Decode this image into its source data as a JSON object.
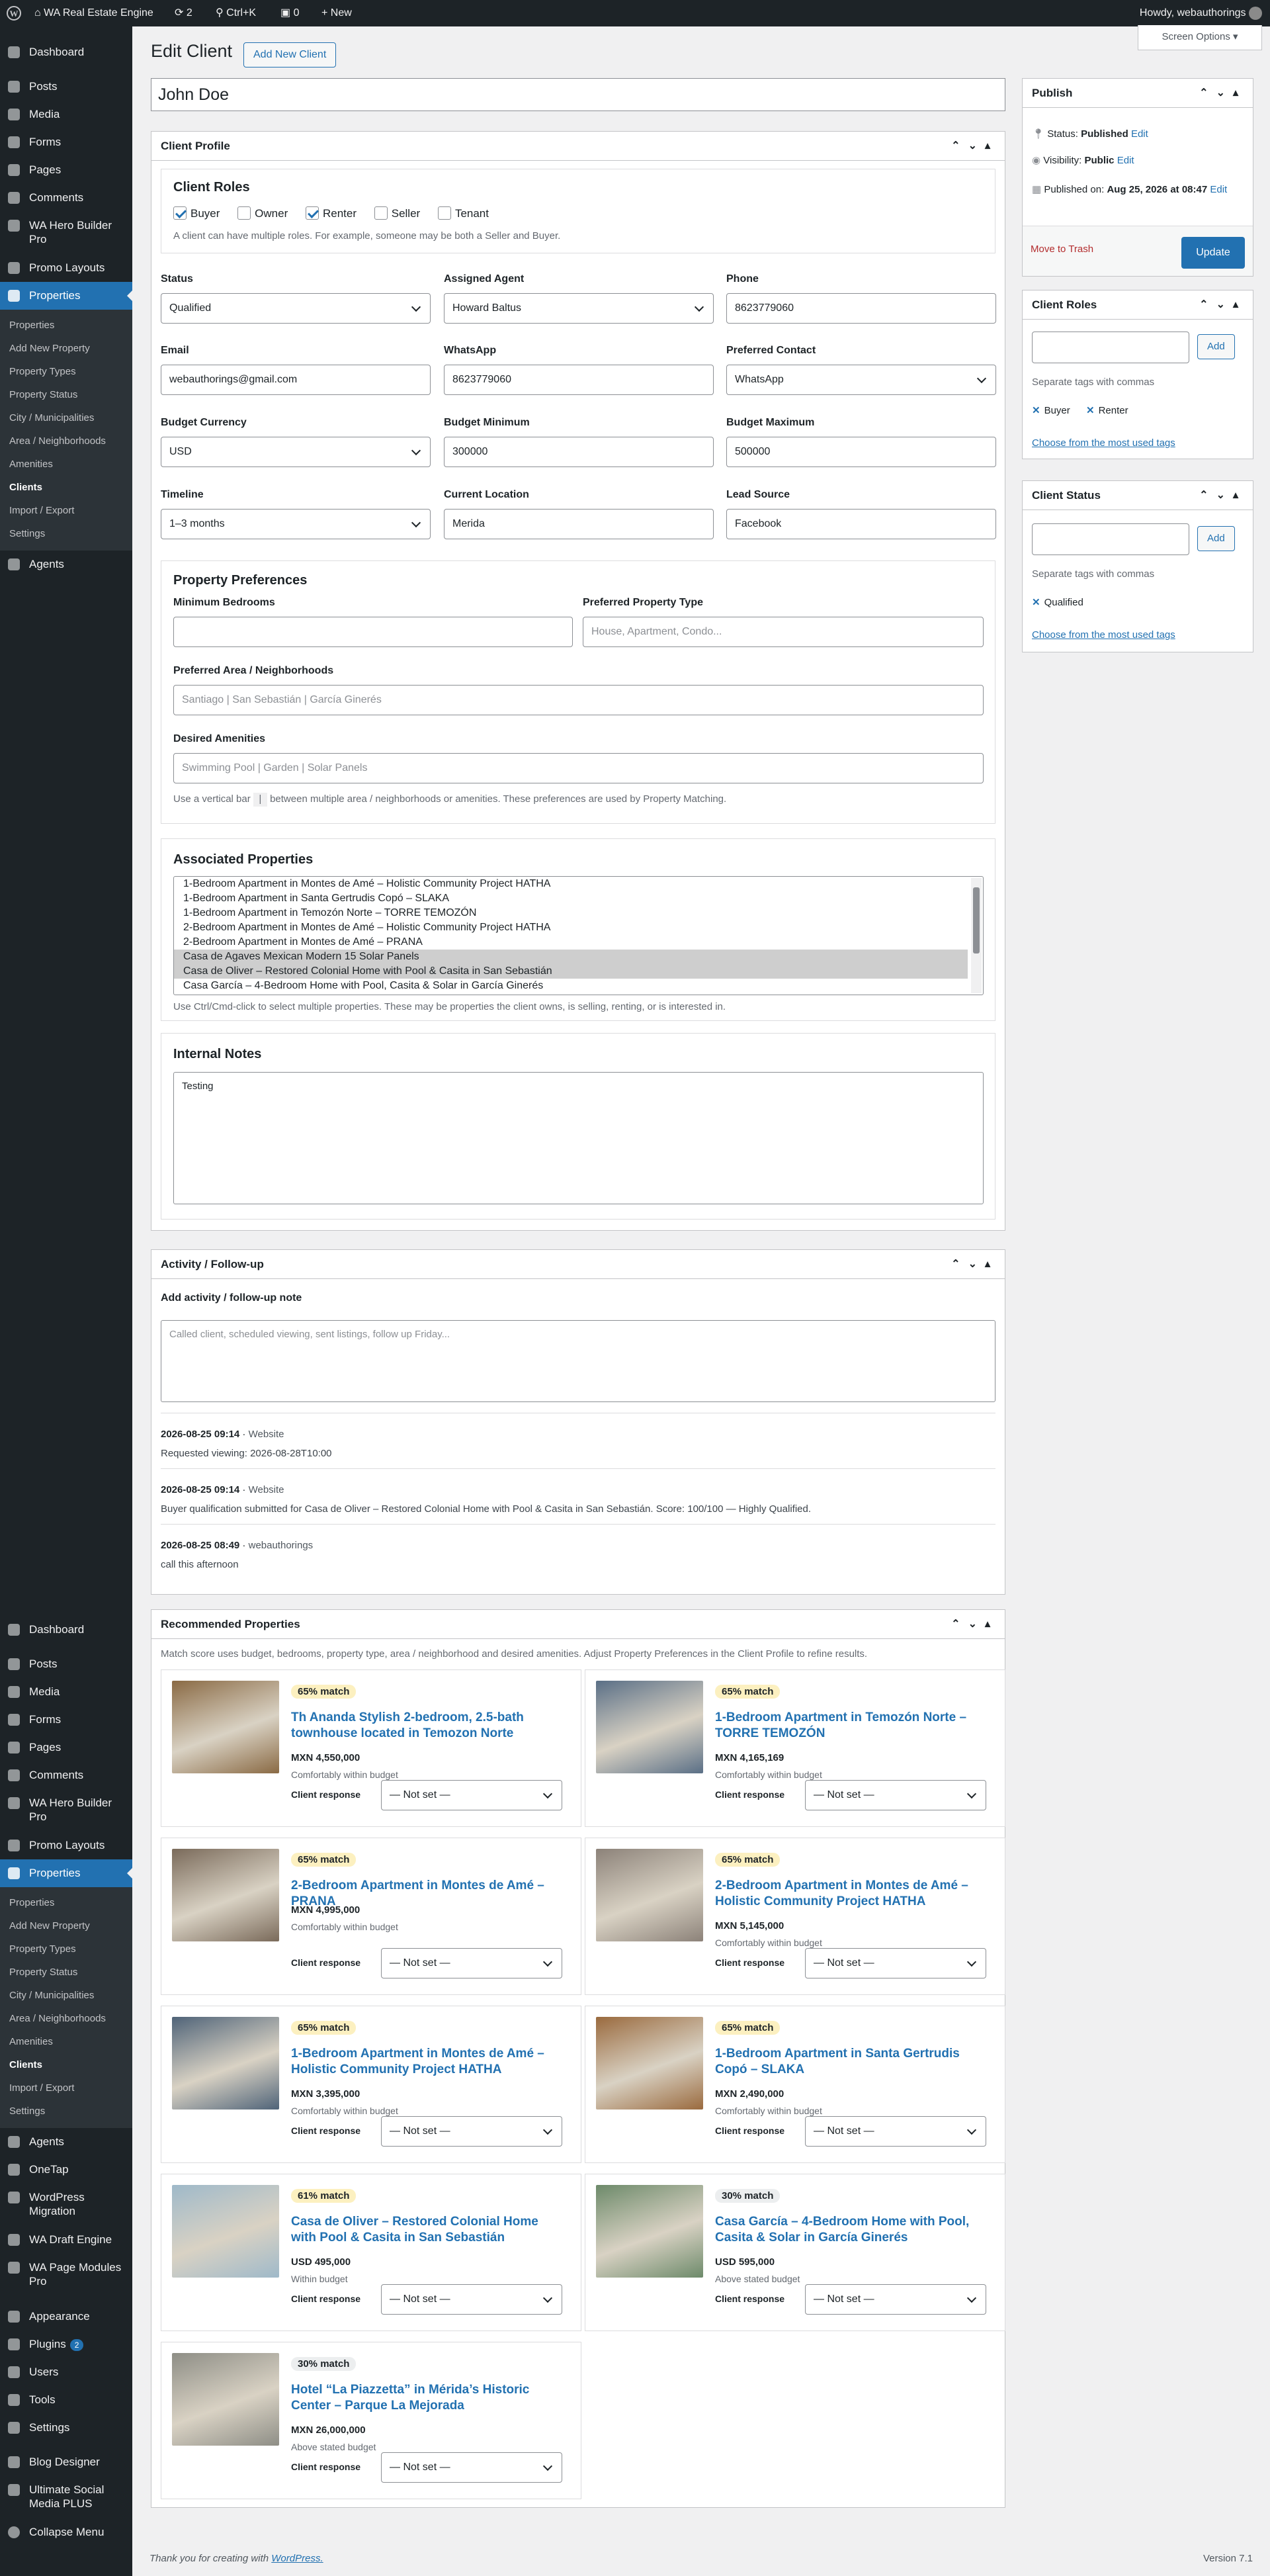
{
  "adminbar": {
    "site": "WA Real Estate Engine",
    "updates": "2",
    "search": "Ctrl+K",
    "comments": "0",
    "new": "New",
    "howdy": "Howdy, webauthorings"
  },
  "menu": {
    "top": [
      {
        "label": "Dashboard",
        "icon": "dashboard-icon"
      },
      {
        "label": "Posts",
        "icon": "pin-icon"
      },
      {
        "label": "Media",
        "icon": "media-icon"
      },
      {
        "label": "Forms",
        "icon": "forms-icon"
      },
      {
        "label": "Pages",
        "icon": "pages-icon"
      },
      {
        "label": "Comments",
        "icon": "comments-icon"
      },
      {
        "label": "WA Hero Builder Pro",
        "icon": "hero-icon"
      },
      {
        "label": "Promo Layouts",
        "icon": "layout-icon"
      },
      {
        "label": "Properties",
        "icon": "home-icon"
      }
    ],
    "sub": [
      "Properties",
      "Add New Property",
      "Property Types",
      "Property Status",
      "City / Municipalities",
      "Area / Neighborhoods",
      "Amenities",
      "Clients",
      "Import / Export",
      "Settings"
    ],
    "after": [
      {
        "label": "Agents",
        "icon": "agents-icon"
      },
      {
        "label": "OneTap",
        "icon": "onetap-icon"
      },
      {
        "label": "WordPress Migration",
        "icon": "migration-icon"
      },
      {
        "label": "WA Draft Engine",
        "icon": "draft-icon"
      },
      {
        "label": "WA Page Modules Pro",
        "icon": "modules-icon"
      },
      {
        "label": "Appearance",
        "icon": "appearance-icon"
      },
      {
        "label": "Plugins",
        "icon": "plugins-icon",
        "badge": "2"
      },
      {
        "label": "Users",
        "icon": "users-icon"
      },
      {
        "label": "Tools",
        "icon": "tools-icon"
      },
      {
        "label": "Settings",
        "icon": "settings-icon"
      },
      {
        "label": "Blog Designer",
        "icon": "blog-icon"
      },
      {
        "label": "Ultimate Social Media PLUS",
        "icon": "social-icon"
      },
      {
        "label": "Collapse Menu",
        "icon": "collapse-icon"
      }
    ]
  },
  "page": {
    "title": "Edit Client",
    "add_new": "Add New Client",
    "screen_options": "Screen Options",
    "post_title": "John Doe"
  },
  "profile": {
    "header": "Client Profile",
    "roles_title": "Client Roles",
    "roles": [
      {
        "label": "Buyer",
        "checked": true
      },
      {
        "label": "Owner",
        "checked": false
      },
      {
        "label": "Renter",
        "checked": true
      },
      {
        "label": "Seller",
        "checked": false
      },
      {
        "label": "Tenant",
        "checked": false
      }
    ],
    "roles_help": "A client can have multiple roles. For example, someone may be both a Seller and Buyer.",
    "fields": {
      "status_l": "Status",
      "status": "Qualified",
      "agent_l": "Assigned Agent",
      "agent": "Howard Baltus",
      "phone_l": "Phone",
      "phone": "8623779060",
      "email_l": "Email",
      "email": "webauthorings@gmail.com",
      "wa_l": "WhatsApp",
      "wa": "8623779060",
      "contact_l": "Preferred Contact",
      "contact": "WhatsApp",
      "cur_l": "Budget Currency",
      "cur": "USD",
      "bmin_l": "Budget Minimum",
      "bmin": "300000",
      "bmax_l": "Budget Maximum",
      "bmax": "500000",
      "timeline_l": "Timeline",
      "timeline": "1–3 months",
      "loc_l": "Current Location",
      "loc": "Merida",
      "lead_l": "Lead Source",
      "lead": "Facebook"
    },
    "prefs": {
      "title": "Property Preferences",
      "beds_l": "Minimum Bedrooms",
      "type_l": "Preferred Property Type",
      "type_ph": "House, Apartment, Condo...",
      "area_l": "Preferred Area / Neighborhoods",
      "area_ph": "Santiago | San Sebastián | García Ginerés",
      "amen_l": "Desired Amenities",
      "amen_ph": "Swimming Pool | Garden | Solar Panels",
      "help_a": "Use a vertical bar",
      "help_bar": "|",
      "help_b": "between multiple area / neighborhoods or amenities. These preferences are used by Property Matching."
    },
    "assoc": {
      "title": "Associated Properties",
      "items": [
        {
          "t": "1-Bedroom Apartment in Montes de Amé – Holistic Community Project HATHA",
          "s": false
        },
        {
          "t": "1-Bedroom Apartment in Santa Gertrudis Copó – SLAKA",
          "s": false
        },
        {
          "t": "1-Bedroom Apartment in Temozón Norte – TORRE TEMOZÓN",
          "s": false
        },
        {
          "t": "2-Bedroom Apartment in Montes de Amé – Holistic Community Project HATHA",
          "s": false
        },
        {
          "t": "2-Bedroom Apartment in Montes de Amé – PRANA",
          "s": false
        },
        {
          "t": "Casa de Agaves Mexican Modern 15 Solar Panels",
          "s": true
        },
        {
          "t": "Casa de Oliver – Restored Colonial Home with Pool & Casita in San Sebastián",
          "s": true
        },
        {
          "t": "Casa García – 4-Bedroom Home with Pool, Casita & Solar in García Ginerés",
          "s": false
        }
      ],
      "help": "Use Ctrl/Cmd-click to select multiple properties. These may be properties the client owns, is selling, renting, or is interested in."
    },
    "notes": {
      "title": "Internal Notes",
      "value": "Testing"
    }
  },
  "activity": {
    "header": "Activity / Follow-up",
    "add_l": "Add activity / follow-up note",
    "ph": "Called client, scheduled viewing, sent listings, follow up Friday...",
    "entries": [
      {
        "date": "2026-08-25 09:14",
        "src": "Website",
        "text": "Requested viewing: 2026-08-28T10:00"
      },
      {
        "date": "2026-08-25 09:14",
        "src": "Website",
        "text": "Buyer qualification submitted for Casa de Oliver – Restored Colonial Home with Pool & Casita in San Sebastián. Score: 100/100 — Highly Qualified."
      },
      {
        "date": "2026-08-25 08:49",
        "src": "webauthorings",
        "text": "call this afternoon"
      }
    ]
  },
  "recommended": {
    "header": "Recommended Properties",
    "intro": "Match score uses budget, bedrooms, property type, area / neighborhood and desired amenities. Adjust Property Preferences in the Client Profile to refine results.",
    "resp_l": "Client response",
    "not_set": "— Not set —",
    "cards": [
      {
        "pct": "65% match",
        "title": "Th Ananda Stylish 2-bedroom, 2.5-bath townhouse located in Temozon Norte",
        "price": "MXN 4,550,000",
        "fit": "Comfortably within budget",
        "img": "#8a6a44"
      },
      {
        "pct": "65% match",
        "title": "1-Bedroom Apartment in Temozón Norte – TORRE TEMOZÓN",
        "price": "MXN 4,165,169",
        "fit": "Comfortably within budget",
        "img": "#5a6f86"
      },
      {
        "pct": "65% match",
        "title": "2-Bedroom Apartment in Montes de Amé – PRANA",
        "price": "MXN 4,995,000",
        "fit": "Comfortably within budget",
        "img": "#7a6a5a"
      },
      {
        "pct": "65% match",
        "title": "2-Bedroom Apartment in Montes de Amé – Holistic Community Project HATHA",
        "price": "MXN 5,145,000",
        "fit": "Comfortably within budget",
        "img": "#8c8279"
      },
      {
        "pct": "65% match",
        "title": "1-Bedroom Apartment in Montes de Amé – Holistic Community Project HATHA",
        "price": "MXN 3,395,000",
        "fit": "Comfortably within budget",
        "img": "#4f6378"
      },
      {
        "pct": "65% match",
        "title": "1-Bedroom Apartment in Santa Gertrudis Copó – SLAKA",
        "price": "MXN 2,490,000",
        "fit": "Comfortably within budget",
        "img": "#9a6a3e"
      },
      {
        "pct": "61% match",
        "title": "Casa de Oliver – Restored Colonial Home with Pool & Casita in San Sebastián",
        "price": "USD 495,000",
        "fit": "Within budget",
        "img": "#9fb9c9"
      },
      {
        "pct": "30% match",
        "title": "Casa García – 4-Bedroom Home with Pool, Casita & Solar in García Ginerés",
        "price": "USD 595,000",
        "fit": "Above stated budget",
        "img": "#6d8a6a"
      },
      {
        "pct": "30% match",
        "title": "Hotel “La Piazzetta” in Mérida’s Historic Center – Parque La Mejorada",
        "price": "MXN 26,000,000",
        "fit": "Above stated budget",
        "img": "#8e8e86"
      }
    ]
  },
  "publish": {
    "header": "Publish",
    "status_l": "Status:",
    "status": "Published",
    "edit": "Edit",
    "vis_l": "Visibility:",
    "vis": "Public",
    "pub_l": "Published on:",
    "pub": "Aug 25, 2026 at 08:47",
    "trash": "Move to Trash",
    "update": "Update"
  },
  "roles_box": {
    "header": "Client Roles",
    "add": "Add",
    "help": "Separate tags with commas",
    "tags": [
      "Buyer",
      "Renter"
    ],
    "most": "Choose from the most used tags"
  },
  "status_box": {
    "header": "Client Status",
    "add": "Add",
    "help": "Separate tags with commas",
    "tags": [
      "Qualified"
    ],
    "most": "Choose from the most used tags"
  },
  "footer": {
    "thanks": "Thank you for creating with",
    "wp": "WordPress.",
    "version": "Version 7.1"
  },
  "colors": {
    "accent": "#2271b1",
    "primary_button": "#2271b1",
    "trash": "#b32d2e",
    "match_high": "#fcf0c0",
    "sidebar": "#1d2327"
  }
}
